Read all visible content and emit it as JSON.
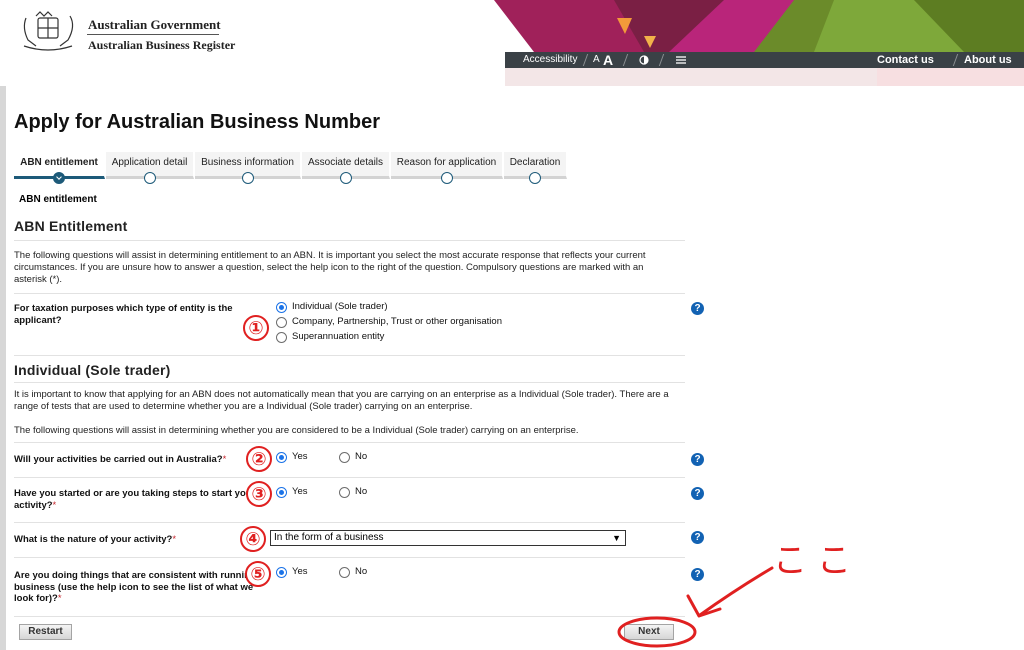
{
  "header": {
    "gov_line1": "Australian Government",
    "gov_line2": "Australian Business Register",
    "accessibility": "Accessibility",
    "text_small": "A",
    "text_large": "A",
    "contact_us": "Contact us",
    "about_us": "About us"
  },
  "page_title": "Apply for Australian Business Number",
  "steps": [
    {
      "label": "ABN entitlement",
      "state": "current"
    },
    {
      "label": "Application detail",
      "state": "pending"
    },
    {
      "label": "Business information",
      "state": "pending"
    },
    {
      "label": "Associate details",
      "state": "pending"
    },
    {
      "label": "Reason for application",
      "state": "pending"
    },
    {
      "label": "Declaration",
      "state": "pending"
    }
  ],
  "breadcrumb": "ABN entitlement",
  "section1": {
    "heading": "ABN Entitlement",
    "intro": "The following questions will assist in determining entitlement to an ABN. It is important you select the most accurate response that reflects your current circumstances. If you are unsure how to answer a question, select the help icon to the right of the question. Compulsory questions are marked with an asterisk (*).",
    "entity_question": "For taxation purposes which type of entity is the applicant?",
    "entity_options": [
      "Individual (Sole trader)",
      "Company, Partnership, Trust or other organisation",
      "Superannuation entity"
    ],
    "entity_selected": 0
  },
  "section2": {
    "heading": "Individual (Sole trader)",
    "para1": "It is important to know that applying for an ABN does not automatically mean that you are carrying on an enterprise as a Individual (Sole trader). There are a range of tests that are used to determine whether you are a Individual (Sole trader) carrying on an enterprise.",
    "para2": "The following questions will assist in determining whether you are considered to be a Individual (Sole trader) carrying on an enterprise.",
    "q_australia": "Will your activities be carried out in Australia?",
    "q_started": "Have you started or are you taking steps to start your activity?",
    "q_nature": "What is the nature of your activity?",
    "q_consistent": "Are you doing things that are consistent with running a business (use the help icon to see the list of what we look for)?",
    "required_mark": "*",
    "yes": "Yes",
    "no": "No",
    "nature_value": "In the form of a business"
  },
  "buttons": {
    "restart": "Restart",
    "next": "Next"
  },
  "annotations": {
    "markers": [
      "①",
      "②",
      "③",
      "④",
      "⑤"
    ],
    "note": "ここ",
    "color": "#e02020"
  },
  "help_icon": "?"
}
